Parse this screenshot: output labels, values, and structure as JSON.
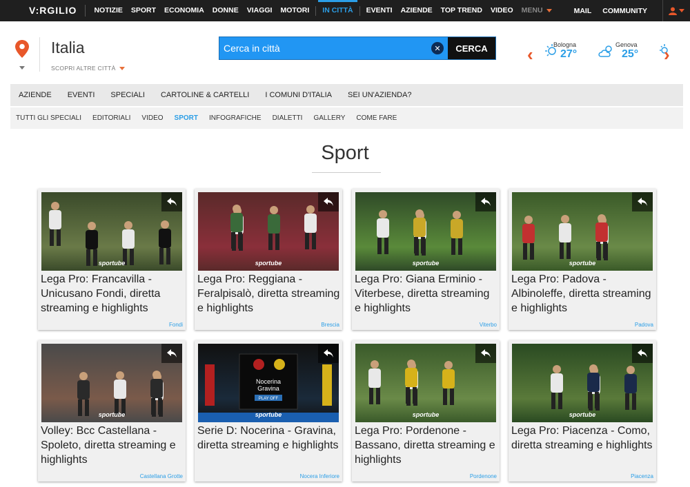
{
  "topbar": {
    "logo": "V:RGILIO",
    "nav": [
      "NOTIZIE",
      "SPORT",
      "ECONOMIA",
      "DONNE",
      "VIAGGI",
      "MOTORI",
      "IN CITTÀ",
      "EVENTI",
      "AZIENDE",
      "TOP TREND",
      "VIDEO"
    ],
    "active": "IN CITTÀ",
    "menu_label": "MENU",
    "mail_label": "MAIL",
    "community_label": "COMMUNITY"
  },
  "header": {
    "city": "Italia",
    "other_cities": "SCOPRI ALTRE CITTÀ",
    "search_placeholder": "Cerca in città",
    "search_button": "CERCA"
  },
  "weather": [
    {
      "city": "Bologna",
      "temp": "27°",
      "icon": "sun-cloud-icon"
    },
    {
      "city": "Genova",
      "temp": "25°",
      "icon": "cloud-sun-icon"
    }
  ],
  "section_nav": [
    "AZIENDE",
    "EVENTI",
    "SPECIALI",
    "CARTOLINE & CARTELLI",
    "I COMUNI D'ITALIA",
    "SEI UN'AZIENDA?"
  ],
  "sub_nav": [
    "TUTTI GLI SPECIALI",
    "EDITORIALI",
    "VIDEO",
    "SPORT",
    "INFOGRAFICHE",
    "DIALETTI",
    "GALLERY",
    "COME FARE"
  ],
  "sub_nav_active": "SPORT",
  "page_title": "Sport",
  "cards": [
    {
      "title": "Lega Pro: Francavilla - Unicusano Fondi, diretta streaming e highlights",
      "location": "Fondi",
      "brand": "sportube",
      "colors": [
        "#3a4a2a",
        "#6a7a48",
        "#111"
      ]
    },
    {
      "title": "Lega Pro: Reggiana - Feralpisalò, diretta streaming e highlights",
      "location": "Brescia",
      "brand": "sportube",
      "colors": [
        "#5a2a2a",
        "#8a2f3a",
        "#3a6a3a"
      ]
    },
    {
      "title": "Lega Pro: Giana Erminio - Viterbese, diretta streaming e highlights",
      "location": "Viterbo",
      "brand": "sportube",
      "colors": [
        "#2f4a28",
        "#5a8a3a",
        "#c9a828"
      ]
    },
    {
      "title": "Lega Pro: Padova - Albinoleffe, diretta streaming e highlights",
      "location": "Padova",
      "brand": "sportube",
      "colors": [
        "#3a5a28",
        "#6a8a48",
        "#c23030"
      ]
    },
    {
      "title": "Volley: Bcc Castellana - Spoleto, diretta streaming e highlights",
      "location": "Castellana Grotte",
      "brand": "sportube",
      "colors": [
        "#4a4a4a",
        "#7a5a4a",
        "#2a2a2a"
      ]
    },
    {
      "title": "Serie D: Nocerina - Gravina, diretta streaming e highlights",
      "location": "Nocera Inferiore",
      "brand": "sportube",
      "colors": [
        "#111",
        "#1a2a3a",
        "#8a1a1a"
      ]
    },
    {
      "title": "Lega Pro: Pordenone - Bassano, diretta streaming e highlights",
      "location": "Pordenone",
      "brand": "sportube",
      "colors": [
        "#3a5a2a",
        "#6a8a48",
        "#d6b21a"
      ]
    },
    {
      "title": "Lega Pro: Piacenza - Como, diretta streaming e highlights",
      "location": "Piacenza",
      "brand": "sportube",
      "colors": [
        "#2a4a22",
        "#5a7a3a",
        "#1a2a4a"
      ]
    }
  ],
  "match_card": {
    "title": "Nocerina",
    "subtitle": "Gravina",
    "cta": "PLAY OFF"
  }
}
